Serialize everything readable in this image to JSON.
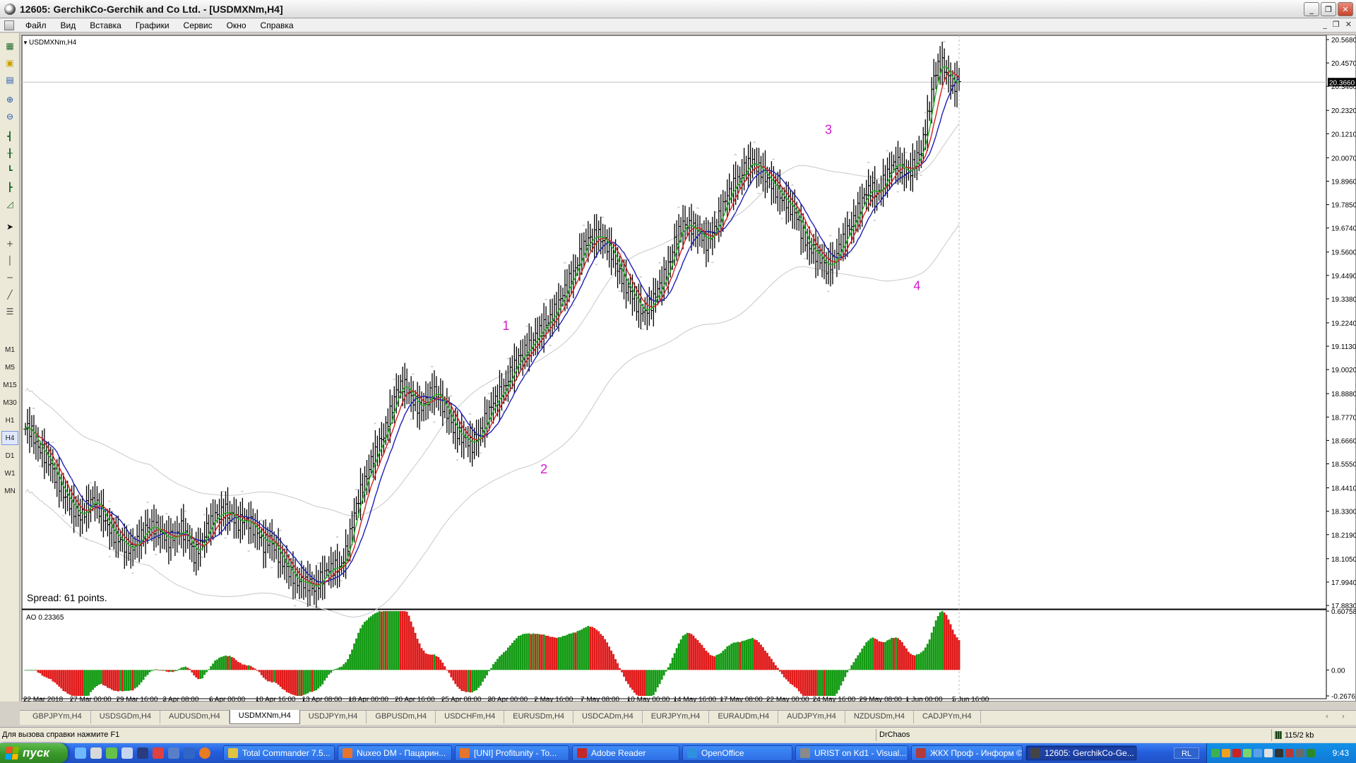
{
  "window": {
    "title": "12605: GerchikCo-Gerchik and Co Ltd. - [USDMXNm,H4]",
    "min": "_",
    "restore": "❐",
    "close": "✕"
  },
  "menu": {
    "items": [
      "Файл",
      "Вид",
      "Вставка",
      "Графики",
      "Сервис",
      "Окно",
      "Справка"
    ],
    "mdi": [
      "_",
      "❐",
      "✕"
    ]
  },
  "timeframes": [
    "M1",
    "M5",
    "M15",
    "M30",
    "H1",
    "H4",
    "D1",
    "W1",
    "MN"
  ],
  "active_timeframe": "H4",
  "chart_data": {
    "type": "candlestick",
    "symbol_label": "USDMXNm,H4",
    "spread_text": "Spread: 61 points.",
    "current_price": "20.3660",
    "price_ticks": [
      "20.5680",
      "20.4570",
      "20.3460",
      "20.2320",
      "20.1210",
      "20.0070",
      "19.8960",
      "19.7850",
      "19.6740",
      "19.5600",
      "19.4490",
      "19.3380",
      "19.2240",
      "19.1130",
      "19.0020",
      "18.8880",
      "18.7770",
      "18.6660",
      "18.5550",
      "18.4410",
      "18.3300",
      "18.2190",
      "18.1050",
      "17.9940",
      "17.8830"
    ],
    "ylim": [
      17.883,
      20.568
    ],
    "time_ticks": [
      "22 Mar 2018",
      "27 Mar 00:00",
      "29 Mar 16:00",
      "3 Apr 08:00",
      "6 Apr 00:00",
      "10 Apr 16:00",
      "13 Apr 08:00",
      "18 Apr 00:00",
      "20 Apr 16:00",
      "25 Apr 08:00",
      "30 Apr 00:00",
      "2 May 16:00",
      "7 May 08:00",
      "10 May 00:00",
      "14 May 16:00",
      "17 May 08:00",
      "22 May 00:00",
      "24 May 16:00",
      "29 May 08:00",
      "1 Jun 00:00",
      "5 Jun 16:00"
    ],
    "wave_labels": [
      {
        "text": "1",
        "x_index": 76,
        "price": 19.19
      },
      {
        "text": "2",
        "x_index": 82,
        "price": 18.51
      },
      {
        "text": "3",
        "x_index": 127,
        "price": 20.12
      },
      {
        "text": "4",
        "x_index": 141,
        "price": 19.38
      }
    ],
    "close_series": [
      18.72,
      18.66,
      18.61,
      18.56,
      18.5,
      18.44,
      18.38,
      18.33,
      18.31,
      18.35,
      18.38,
      18.34,
      18.29,
      18.23,
      18.19,
      18.17,
      18.16,
      18.18,
      18.22,
      18.27,
      18.25,
      18.21,
      18.19,
      18.22,
      18.25,
      18.19,
      18.12,
      18.18,
      18.24,
      18.29,
      18.32,
      18.34,
      18.3,
      18.27,
      18.3,
      18.27,
      18.22,
      18.17,
      18.21,
      18.14,
      18.08,
      18.05,
      18.01,
      17.99,
      17.98,
      17.97,
      18.01,
      18.04,
      18.06,
      18.07,
      18.13,
      18.26,
      18.4,
      18.48,
      18.56,
      18.62,
      18.7,
      18.8,
      18.89,
      18.93,
      18.9,
      18.84,
      18.81,
      18.87,
      18.91,
      18.85,
      18.79,
      18.73,
      18.7,
      18.66,
      18.64,
      18.7,
      18.76,
      18.82,
      18.87,
      18.92,
      18.98,
      19.03,
      19.08,
      19.12,
      19.15,
      19.19,
      19.24,
      19.28,
      19.33,
      19.4,
      19.47,
      19.54,
      19.6,
      19.63,
      19.65,
      19.6,
      19.55,
      19.49,
      19.42,
      19.36,
      19.31,
      19.28,
      19.3,
      19.35,
      19.42,
      19.5,
      19.6,
      19.67,
      19.7,
      19.67,
      19.64,
      19.6,
      19.66,
      19.72,
      19.8,
      19.86,
      19.91,
      19.95,
      19.98,
      19.97,
      19.94,
      19.89,
      19.85,
      19.82,
      19.79,
      19.74,
      19.66,
      19.6,
      19.56,
      19.52,
      19.49,
      19.52,
      19.57,
      19.63,
      19.7,
      19.76,
      19.82,
      19.86,
      19.84,
      19.89,
      19.94,
      19.99,
      19.96,
      19.93,
      19.98,
      20.05,
      20.2,
      20.38,
      20.46,
      20.42,
      20.35,
      20.37
    ],
    "ao_label": "AO 0.23365",
    "ao_ticks": [
      "0.60758",
      "0.00",
      "-0.26761"
    ],
    "ao_ylim": [
      -0.26761,
      0.60758
    ]
  },
  "tabs": [
    "GBPJPYm,H4",
    "USDSGDm,H4",
    "AUDUSDm,H4",
    "USDMXNm,H4",
    "USDJPYm,H4",
    "GBPUSDm,H4",
    "USDCHFm,H4",
    "EURUSDm,H4",
    "USDCADm,H4",
    "EURJPYm,H4",
    "EURAUDm,H4",
    "AUDJPYm,H4",
    "NZDUSDm,H4",
    "CADJPYm,H4"
  ],
  "active_tab": "USDMXNm,H4",
  "tab_arrows": "‹ ›",
  "status": {
    "help": "Для вызова справки нажмите F1",
    "profile": "DrChaos",
    "traffic": "115/2 kb"
  },
  "taskbar": {
    "start": "пуск",
    "items": [
      {
        "label": "Total Commander 7.5...",
        "color": "#e0c341"
      },
      {
        "label": "Nuxeo DM - Пацарин...",
        "color": "#e7742c"
      },
      {
        "label": "[UNI] Profitunity - To...",
        "color": "#e7742c"
      },
      {
        "label": "Adobe Reader",
        "color": "#c62828"
      },
      {
        "label": "OpenOffice",
        "color": "#2f8fe0"
      },
      {
        "label": "URIST on Kd1 - Visual...",
        "color": "#8a8a8a"
      },
      {
        "label": "ЖКХ Проф - Информ ©",
        "color": "#b23a3a"
      },
      {
        "label": "12605: GerchikCo-Ge...",
        "color": "#444444"
      }
    ],
    "active_item": 7,
    "lang": "RL",
    "clock": "9:43"
  }
}
